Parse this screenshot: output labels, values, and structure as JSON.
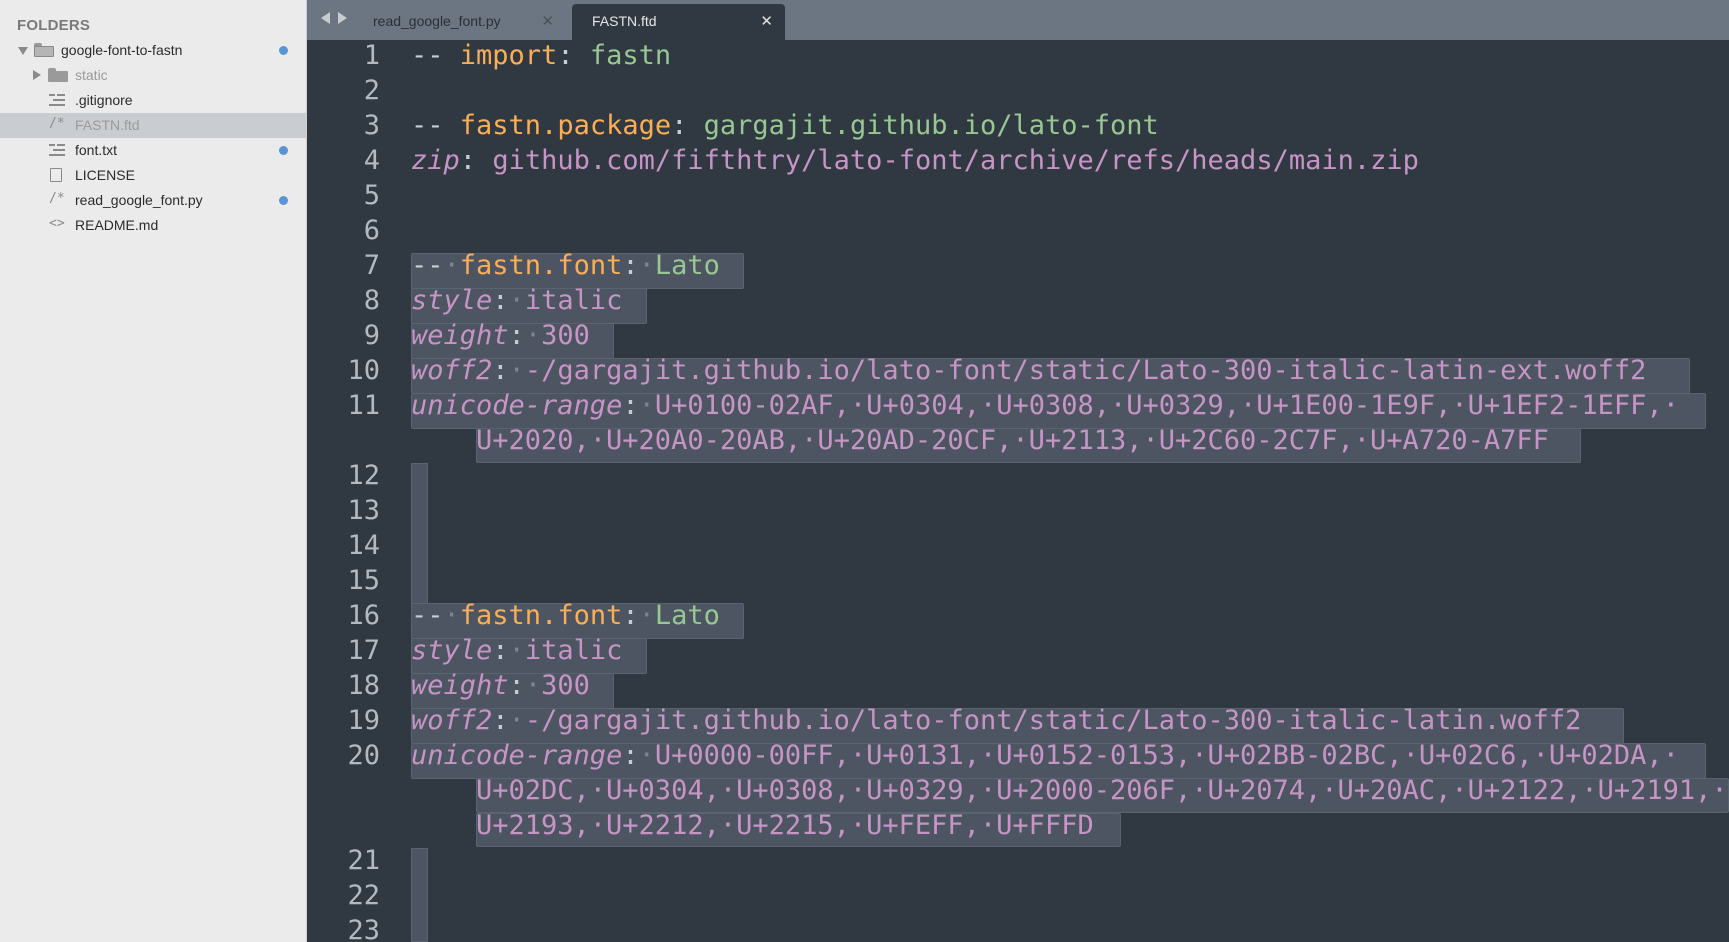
{
  "sidebar": {
    "header": "FOLDERS",
    "root": {
      "label": "google-font-to-fastn",
      "modified": true
    },
    "items": [
      {
        "label": "static",
        "icon": "folder-icon",
        "kind": "folder",
        "dim": true
      },
      {
        "label": ".gitignore",
        "icon": "text-lines-icon",
        "kind": "file"
      },
      {
        "label": "FASTN.ftd",
        "icon": "code-comment-icon",
        "kind": "file",
        "selected": true,
        "dim": true
      },
      {
        "label": "font.txt",
        "icon": "text-lines-icon",
        "kind": "file",
        "modified": true
      },
      {
        "label": "LICENSE",
        "icon": "document-icon",
        "kind": "file"
      },
      {
        "label": "read_google_font.py",
        "icon": "code-comment-icon",
        "kind": "file",
        "modified": true
      },
      {
        "label": "README.md",
        "icon": "markup-icon",
        "kind": "file"
      }
    ]
  },
  "tabs": [
    {
      "label": "read_google_font.py",
      "active": false
    },
    {
      "label": "FASTN.ftd",
      "active": true
    }
  ],
  "editor": {
    "line_numbers": [
      "1",
      "2",
      "3",
      "4",
      "5",
      "6",
      "7",
      "8",
      "9",
      "10",
      "11",
      "12",
      "13",
      "14",
      "15",
      "16",
      "17",
      "18",
      "19",
      "20",
      "21",
      "22",
      "23"
    ],
    "code": {
      "l1_dash": "--",
      "l1_kw": "import",
      "l1_colon": ":",
      "l1_val": "fastn",
      "l3_dash": "--",
      "l3_kw": "fastn.package",
      "l3_colon": ":",
      "l3_val": "gargajit.github.io/lato-font",
      "l4_key": "zip",
      "l4_colon": ":",
      "l4_val": "github.com/fifthtry/lato-font/archive/refs/heads/main.zip",
      "l7_dash": "--",
      "l7_kw": "fastn.font",
      "l7_colon": ":",
      "l7_val": "Lato",
      "l8_key": "style",
      "l8_val": "italic",
      "l9_key": "weight",
      "l9_val": "300",
      "l10_key": "woff2",
      "l10_val": "-/gargajit.github.io/lato-font/static/Lato-300-italic-latin-ext.woff2",
      "l11_key": "unicode-range",
      "l11_val_a": "U+0100-02AF,·U+0304,·U+0308,·U+0329,·U+1E00-1E9F,·U+1EF2-1EFF,·",
      "l11_val_b": "U+2020,·U+20A0-20AB,·U+20AD-20CF,·U+2113,·U+2C60-2C7F,·U+A720-A7FF",
      "l16_dash": "--",
      "l16_kw": "fastn.font",
      "l16_colon": ":",
      "l16_val": "Lato",
      "l17_key": "style",
      "l17_val": "italic",
      "l18_key": "weight",
      "l18_val": "300",
      "l19_key": "woff2",
      "l19_val": "-/gargajit.github.io/lato-font/static/Lato-300-italic-latin.woff2",
      "l20_key": "unicode-range",
      "l20_val_a": "U+0000-00FF,·U+0131,·U+0152-0153,·U+02BB-02BC,·U+02C6,·U+02DA,·",
      "l20_val_b": "U+02DC,·U+0304,·U+0308,·U+0329,·U+2000-206F,·U+2074,·U+20AC,·U+2122,·U+2191,·",
      "l20_val_c": "U+2193,·U+2212,·U+2215,·U+FEFF,·U+FFFD"
    }
  },
  "colors": {
    "sidebar_bg": "#ebebeb",
    "editor_bg": "#303841",
    "tabbar_bg": "#6c7682",
    "keyword": "#f9ae58",
    "string": "#99c794",
    "key": "#c695c6",
    "selection": "#4c5561",
    "modified_dot": "#5b94d6"
  }
}
